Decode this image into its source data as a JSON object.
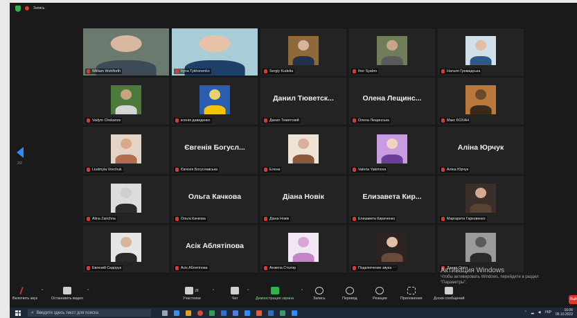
{
  "recording": {
    "label": "Запись"
  },
  "colors": {
    "active_border": "#b7e26b",
    "muted_mic": "#e0392b",
    "nav_arrow": "#2a8cff",
    "share_green": "#2fb24a"
  },
  "gallery": {
    "page_indicator": "2/2",
    "tiles": [
      {
        "name": "William Wohlforth",
        "big": "",
        "photo": "wide",
        "bg": "#6b7a6f",
        "skin": "#d9b8a0",
        "shirt": "#3e4a56",
        "active": true
      },
      {
        "name": "Iryna Tykhonenko",
        "big": "",
        "photo": "wide",
        "bg": "#a8cdd6",
        "skin": "#e8c2a8",
        "shirt": "#1e3f66",
        "active": false
      },
      {
        "name": "Sergiy Kudelia",
        "big": "",
        "photo": "small",
        "bg": "#8e6a3a",
        "skin": "#d8b49a",
        "shirt": "#23324a",
        "active": false
      },
      {
        "name": "Ihor Syabro",
        "big": "",
        "photo": "small",
        "bg": "#6f7d59",
        "skin": "#c9a488",
        "shirt": "#5a5a5a",
        "active": false
      },
      {
        "name": "Наталя Громадська",
        "big": "",
        "photo": "small",
        "bg": "#cfe0ea",
        "skin": "#e3bea4",
        "shirt": "#2d5a88",
        "active": false
      },
      {
        "name": "Vadym Chekanov",
        "big": "",
        "photo": "small",
        "bg": "#4b7a3a",
        "skin": "#c9a27e",
        "shirt": "#d6d6d6",
        "active": false
      },
      {
        "name": "ксенія давиденко",
        "big": "",
        "photo": "small",
        "bg": "#2a5db0",
        "skin": "#e8d36a",
        "shirt": "#f2c500",
        "active": false
      },
      {
        "name": "Данил Тюветский",
        "big": "Данил Тюветск...",
        "photo": "",
        "active": false
      },
      {
        "name": "Олена Лещинська",
        "big": "Олена Лещинс...",
        "photo": "",
        "active": false
      },
      {
        "name": "Макс БОХАН",
        "big": "",
        "photo": "small",
        "bg": "#b8793a",
        "skin": "#6a4a2a",
        "shirt": "#3a2a1a",
        "active": false
      },
      {
        "name": "Liudmyla Vovchuk",
        "big": "",
        "photo": "small",
        "bg": "#e4d4c6",
        "skin": "#d9a98a",
        "shirt": "#b26d4f",
        "active": false
      },
      {
        "name": "Євгенія Богуславська",
        "big": "Євгенія Богусл...",
        "photo": "",
        "active": false
      },
      {
        "name": "Елена",
        "big": "",
        "photo": "small",
        "bg": "#efe3d6",
        "skin": "#d9b09a",
        "shirt": "#8b5a3c",
        "active": false
      },
      {
        "name": "Valeria Yakimova",
        "big": "",
        "photo": "small",
        "bg": "#c99be0",
        "skin": "#f2d3c0",
        "shirt": "#6a3f99",
        "active": false
      },
      {
        "name": "Аліна Юрчук",
        "big": "Аліна Юрчук",
        "photo": "",
        "active": false
      },
      {
        "name": "Alina Zarichna",
        "big": "",
        "photo": "small",
        "bg": "#dcdcdc",
        "skin": "#cfcfcf",
        "shirt": "#2a2a2a",
        "active": false
      },
      {
        "name": "Ольга Качкова",
        "big": "Ольга Качкова",
        "photo": "",
        "active": false
      },
      {
        "name": "Діана Новік",
        "big": "Діана Новік",
        "photo": "",
        "active": false
      },
      {
        "name": "Елизавета Кириченко",
        "big": "Елизавета Кир...",
        "photo": "",
        "active": false
      },
      {
        "name": "Маргарита Гарковенко",
        "big": "",
        "photo": "small",
        "bg": "#3a2f2a",
        "skin": "#d4a990",
        "shirt": "#5a4232",
        "active": false
      },
      {
        "name": "Евгений Сидорук",
        "big": "",
        "photo": "small",
        "bg": "#e6e6e6",
        "skin": "#d8b49a",
        "shirt": "#2a2a2a",
        "active": false
      },
      {
        "name": "Асік Аблятіпова",
        "big": "Асік Аблятіпова",
        "photo": "",
        "active": false
      },
      {
        "name": "Анжела Столяр",
        "big": "",
        "photo": "small",
        "bg": "#f2e8f4",
        "skin": "#d9a5d8",
        "shirt": "#c583c9",
        "active": false
      },
      {
        "name": "Подключение звука ⋯",
        "big": "",
        "photo": "small",
        "bg": "#2b2420",
        "skin": "#e3bfa6",
        "shirt": "#6a4a3a",
        "active": false
      },
      {
        "name": "Данил Орёл",
        "big": "",
        "photo": "small",
        "bg": "#9a9a9a",
        "skin": "#5a5a5a",
        "shirt": "#2a2a2a",
        "active": false
      }
    ]
  },
  "toolbar": {
    "unmute": "Включить звук",
    "start_video": "Остановить видео",
    "participants_count": "28",
    "participants": "Участники",
    "chat": "Чат",
    "share": "Демонстрация экрана",
    "record": "Запись",
    "translate": "Перевод",
    "reactions": "Реакции",
    "apps": "Приложения",
    "whiteboards": "Доски сообщений",
    "end": "Вый"
  },
  "watermark": {
    "line1": "Активация Windows",
    "line2": "Чтобы активировать Windows, перейдите в раздел",
    "line3": "\"Параметры\"."
  },
  "taskbar": {
    "search_placeholder": "Введите здесь текст для поиска",
    "lang": "УКР",
    "time": "16:06",
    "date": "05.10.2022"
  }
}
